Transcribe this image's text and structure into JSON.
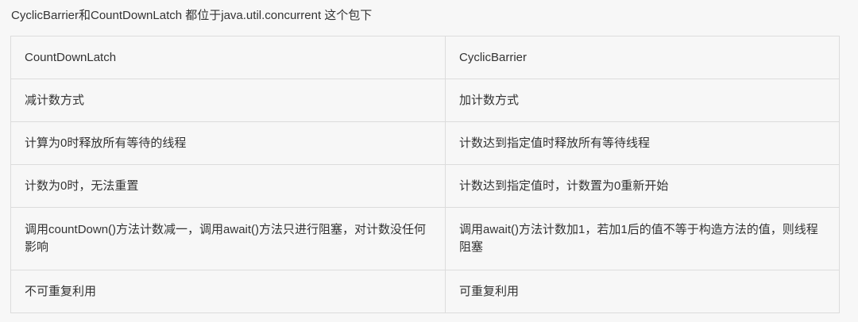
{
  "intro": "CyclicBarrier和CountDownLatch 都位于java.util.concurrent 这个包下",
  "table": {
    "rows": [
      [
        "CountDownLatch",
        "CyclicBarrier"
      ],
      [
        "减计数方式",
        "加计数方式"
      ],
      [
        "计算为0时释放所有等待的线程",
        "计数达到指定值时释放所有等待线程"
      ],
      [
        "计数为0时，无法重置",
        "计数达到指定值时，计数置为0重新开始"
      ],
      [
        "调用countDown()方法计数减一，调用await()方法只进行阻塞，对计数没任何影响",
        "调用await()方法计数加1，若加1后的值不等于构造方法的值，则线程阻塞"
      ],
      [
        "不可重复利用",
        "可重复利用"
      ]
    ]
  }
}
